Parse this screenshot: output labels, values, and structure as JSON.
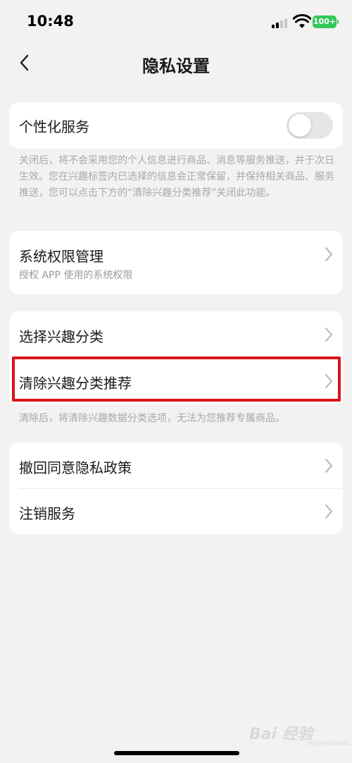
{
  "status_bar": {
    "time": "10:48",
    "battery": "100+"
  },
  "nav": {
    "title": "隐私设置",
    "back_icon": "chevron-left-icon"
  },
  "personalization": {
    "label": "个性化服务",
    "toggle_on": false,
    "description": "关闭后，将不会采用您的个人信息进行商品、消息等服务推送，并于次日生效。您在兴趣标签内已选择的信息会正常保留，并保持相关商品、服务推送，您可以点击下方的“清除兴趣分类推荐”关闭此功能。"
  },
  "system_permission": {
    "label": "系统权限管理",
    "sub": "授权 APP 使用的系统权限"
  },
  "interest": {
    "items": [
      {
        "label": "选择兴趣分类"
      },
      {
        "label": "清除兴趣分类推荐"
      }
    ],
    "description": "清除后，将清除兴趣数据分类选项，无法为您推荐专属商品。"
  },
  "policy": {
    "items": [
      {
        "label": "撤回同意隐私政策"
      },
      {
        "label": "注销服务"
      }
    ]
  },
  "watermark": {
    "text": "Bai 经验",
    "sub": "jingyan.baidu.com"
  },
  "colors": {
    "highlight": "#d8141b",
    "battery": "#34c759",
    "background": "#f2f2f2"
  }
}
